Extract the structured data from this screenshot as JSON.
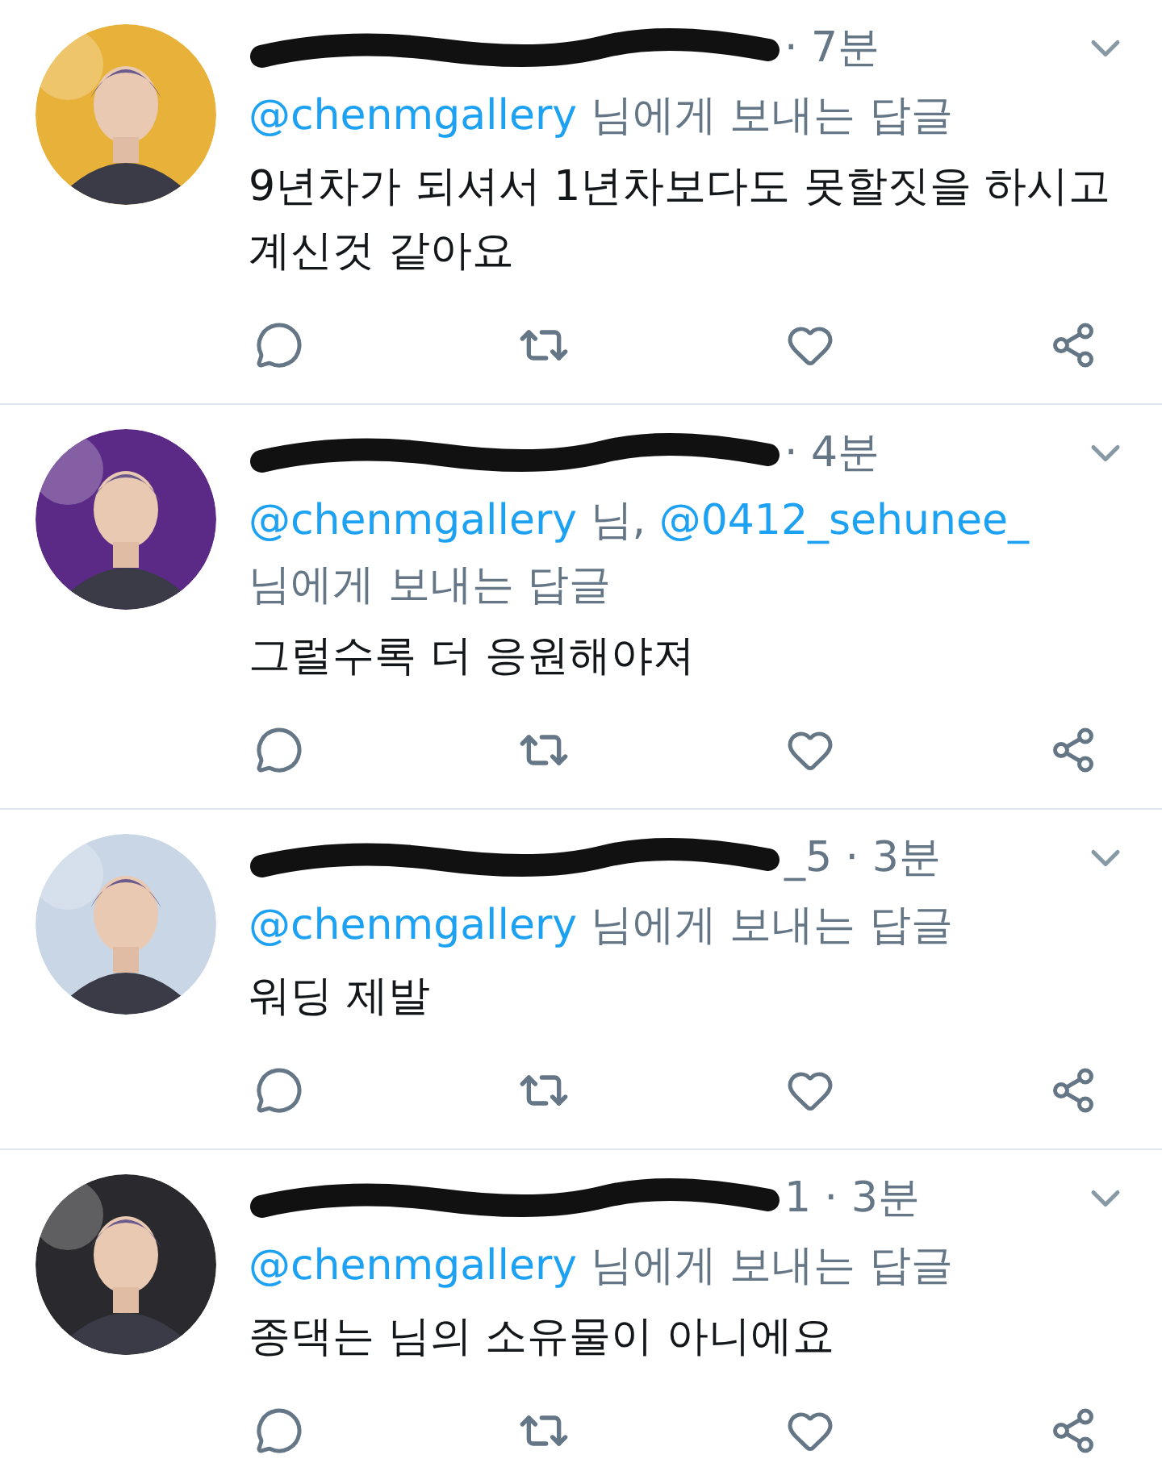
{
  "tweets": [
    {
      "meta": "· 7분",
      "reply_to": [
        {
          "kind": "mention",
          "text": "@chenmgallery"
        },
        {
          "kind": "plain",
          "text": "님에게 보내는 답글"
        }
      ],
      "text": "9년차가 되셔서 1년차보다도 못할짓을 하시고 계신것 같아요"
    },
    {
      "meta": "· 4분",
      "reply_to": [
        {
          "kind": "mention",
          "text": "@chenmgallery"
        },
        {
          "kind": "plain",
          "text": "님,"
        },
        {
          "kind": "mention",
          "text": "@0412_sehunee_"
        },
        {
          "kind": "plain",
          "text": "님에게 보내는 답글"
        }
      ],
      "text": "그럴수록 더 응원해야져"
    },
    {
      "meta": "_5 · 3분",
      "reply_to": [
        {
          "kind": "mention",
          "text": "@chenmgallery"
        },
        {
          "kind": "plain",
          "text": "님에게 보내는 답글"
        }
      ],
      "text": "워딩 제발"
    },
    {
      "meta": "1 · 3분",
      "reply_to": [
        {
          "kind": "mention",
          "text": "@chenmgallery"
        },
        {
          "kind": "plain",
          "text": "님에게 보내는 답글"
        }
      ],
      "text": "종댁는 님의 소유물이 아니에요"
    }
  ]
}
